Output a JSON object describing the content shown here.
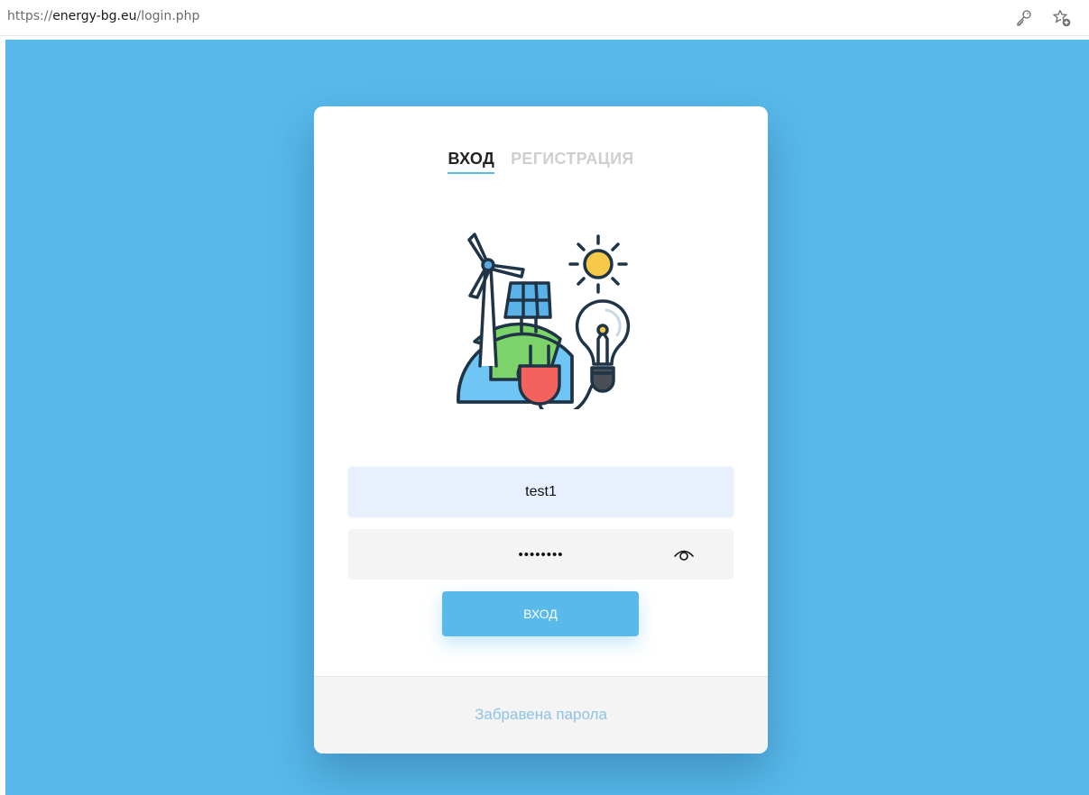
{
  "browser": {
    "url_scheme": "https://",
    "url_host": "energy-bg.eu",
    "url_path": "/login.php",
    "icons": [
      "key-icon",
      "favorites-add-icon"
    ]
  },
  "login": {
    "tabs": [
      {
        "label": "ВХОД",
        "active": true
      },
      {
        "label": "РЕГИСТРАЦИЯ",
        "active": false
      }
    ],
    "illustration": "renewable-energy-icon",
    "username_value": "test1",
    "password_value": "12345678",
    "show_password_icon": "eye-icon",
    "submit_label": "ВХОД",
    "forgot_label": "Забравена парола"
  },
  "colors": {
    "background": "#58b9ea",
    "accent": "#58b9ea",
    "card": "#ffffff",
    "link": "#8ec3e3",
    "inactive_tab": "#cfcfcf"
  }
}
